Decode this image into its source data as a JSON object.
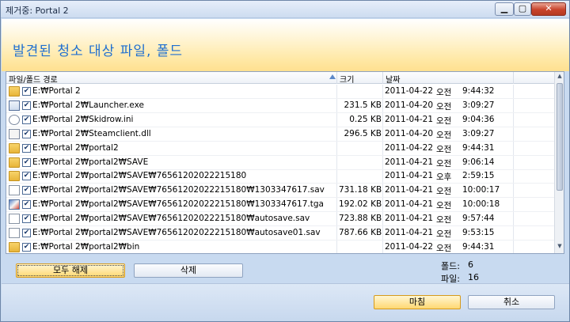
{
  "window": {
    "title": "제거중: Portal 2",
    "min_label": "▁",
    "max_label": "▢",
    "close_label": "✕"
  },
  "banner": {
    "title": "발견된 청소 대상 파일, 폴드"
  },
  "table": {
    "columns": [
      "파일/폴드 경로",
      "크기",
      "날짜"
    ],
    "rows": [
      {
        "icon": "folder-icon",
        "checked": true,
        "path": "E:₩Portal 2",
        "size": "",
        "date": [
          "2011-04-22",
          "오전",
          "9:44:32"
        ]
      },
      {
        "icon": "exe-icon",
        "checked": true,
        "path": "E:₩Portal 2₩Launcher.exe",
        "size": "231.5 KB",
        "date": [
          "2011-04-20",
          "오전",
          "3:09:27"
        ]
      },
      {
        "icon": "settings-file-icon",
        "checked": true,
        "path": "E:₩Portal 2₩Skidrow.ini",
        "size": "0.25 KB",
        "date": [
          "2011-04-21",
          "오전",
          "9:04:36"
        ]
      },
      {
        "icon": "dll-file-icon",
        "checked": true,
        "path": "E:₩Portal 2₩Steamclient.dll",
        "size": "296.5 KB",
        "date": [
          "2011-04-20",
          "오전",
          "3:09:27"
        ]
      },
      {
        "icon": "folder-icon",
        "checked": true,
        "path": "E:₩Portal 2₩portal2",
        "size": "",
        "date": [
          "2011-04-22",
          "오전",
          "9:44:31"
        ]
      },
      {
        "icon": "folder-icon",
        "checked": true,
        "path": "E:₩Portal 2₩portal2₩SAVE",
        "size": "",
        "date": [
          "2011-04-21",
          "오전",
          "9:06:14"
        ]
      },
      {
        "icon": "folder-icon",
        "checked": true,
        "path": "E:₩Portal 2₩portal2₩SAVE₩76561202022215180",
        "size": "",
        "date": [
          "2011-04-21",
          "오후",
          "2:59:15"
        ]
      },
      {
        "icon": "file-icon",
        "checked": true,
        "path": "E:₩Portal 2₩portal2₩SAVE₩76561202022215180₩1303347617.sav",
        "size": "731.18 KB",
        "date": [
          "2011-04-21",
          "오전",
          "10:00:17"
        ]
      },
      {
        "icon": "image-file-icon",
        "checked": true,
        "path": "E:₩Portal 2₩portal2₩SAVE₩76561202022215180₩1303347617.tga",
        "size": "192.02 KB",
        "date": [
          "2011-04-21",
          "오전",
          "10:00:18"
        ]
      },
      {
        "icon": "file-icon",
        "checked": true,
        "path": "E:₩Portal 2₩portal2₩SAVE₩76561202022215180₩autosave.sav",
        "size": "723.88 KB",
        "date": [
          "2011-04-21",
          "오전",
          "9:57:44"
        ]
      },
      {
        "icon": "file-icon",
        "checked": true,
        "path": "E:₩Portal 2₩portal2₩SAVE₩76561202022215180₩autosave01.sav",
        "size": "787.66 KB",
        "date": [
          "2011-04-21",
          "오전",
          "9:53:15"
        ]
      },
      {
        "icon": "folder-icon",
        "checked": true,
        "path": "E:₩Portal 2₩portal2₩bin",
        "size": "",
        "date": [
          "2011-04-22",
          "오전",
          "9:44:31"
        ]
      }
    ]
  },
  "actions": {
    "deselect_all": "모두 해제",
    "delete": "삭제"
  },
  "stats": {
    "folders_label": "폴드:",
    "folders_value": "6",
    "files_label": "파일:",
    "files_value": "16"
  },
  "footer": {
    "finish": "마침",
    "cancel": "취소"
  }
}
